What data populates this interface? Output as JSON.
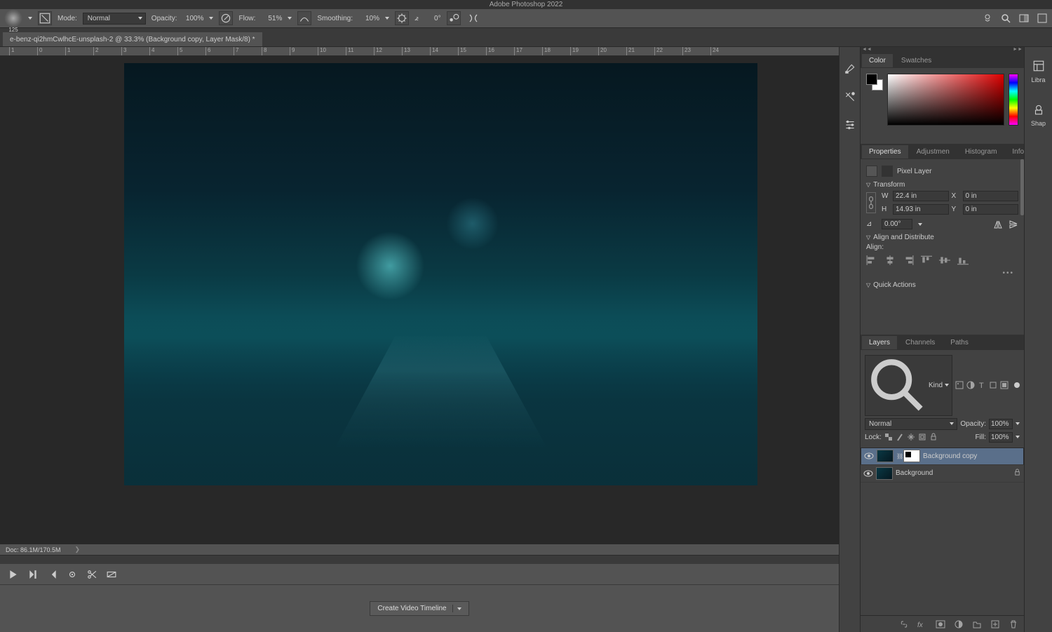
{
  "app": {
    "title": "Adobe Photoshop 2022"
  },
  "optionsBar": {
    "brushSize": "125",
    "modeLabel": "Mode:",
    "mode": "Normal",
    "opacityLabel": "Opacity:",
    "opacity": "100%",
    "flowLabel": "Flow:",
    "flow": "51%",
    "smoothingLabel": "Smoothing:",
    "smoothing": "10%",
    "angleLabel": "⦨",
    "angle": "0°"
  },
  "document": {
    "tab": "e-benz-qi2hmCwlhcE-unsplash-2 @ 33.3% (Background copy, Layer Mask/8) *"
  },
  "ruler": [
    "1",
    "0",
    "1",
    "2",
    "3",
    "4",
    "5",
    "6",
    "7",
    "8",
    "9",
    "10",
    "11",
    "12",
    "13",
    "14",
    "15",
    "16",
    "17",
    "18",
    "19",
    "20",
    "21",
    "22",
    "23",
    "24"
  ],
  "status": {
    "doc": "Doc: 86.1M/170.5M"
  },
  "timeline": {
    "create": "Create Video Timeline"
  },
  "colorPanel": {
    "tabs": [
      "Color",
      "Swatches"
    ]
  },
  "propertiesPanel": {
    "tabs": [
      "Properties",
      "Adjustmen",
      "Histogram",
      "Info"
    ],
    "layerType": "Pixel Layer",
    "transform": {
      "title": "Transform",
      "w": "22.4 in",
      "h": "14.93 in",
      "x": "0 in",
      "y": "0 in",
      "angle": "0.00°"
    },
    "alignTitle": "Align and Distribute",
    "alignLabel": "Align:",
    "quickTitle": "Quick Actions"
  },
  "layersPanel": {
    "tabs": [
      "Layers",
      "Channels",
      "Paths"
    ],
    "kindLabel": "Kind",
    "blend": "Normal",
    "opacityLabel": "Opacity:",
    "opacity": "100%",
    "lockLabel": "Lock:",
    "fillLabel": "Fill:",
    "fill": "100%",
    "items": [
      {
        "name": "Background copy",
        "hasMask": true,
        "selected": true,
        "locked": false
      },
      {
        "name": "Background",
        "hasMask": false,
        "selected": false,
        "locked": true
      }
    ]
  },
  "rightStrip": {
    "libraries": "Libra",
    "shapes": "Shap"
  }
}
